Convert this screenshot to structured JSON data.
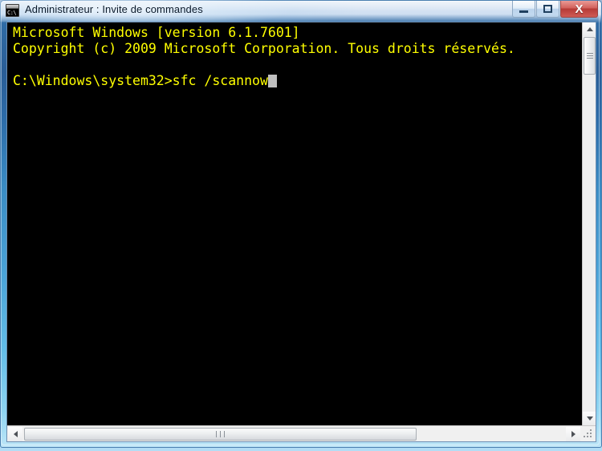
{
  "window": {
    "title": "Administrateur : Invite de commandes",
    "icon": "cmd-console-icon",
    "icon_text": "C:\\",
    "controls": {
      "minimize_label": "—",
      "maximize_label": "□",
      "close_label": "X"
    }
  },
  "console": {
    "foreground_color": "#ffff00",
    "background_color": "#000000",
    "cursor": "block",
    "lines": [
      "Microsoft Windows [version 6.1.7601]",
      "Copyright (c) 2009 Microsoft Corporation. Tous droits réservés.",
      "",
      "C:\\Windows\\system32>sfc /scannow"
    ],
    "prompt": "C:\\Windows\\system32>",
    "command": "sfc /scannow"
  },
  "scrollbars": {
    "vertical": {
      "up_arrow": "▲",
      "down_arrow": "▼",
      "thumb_position": "top"
    },
    "horizontal": {
      "left_arrow": "◀",
      "right_arrow": "▶",
      "thumb_position": "left"
    }
  },
  "colors": {
    "titlebar_blue": "#2a5d96",
    "frame_bottom_blue": "#8ed4f1",
    "close_red": "#b63a36",
    "console_yellow": "#ffff00"
  }
}
